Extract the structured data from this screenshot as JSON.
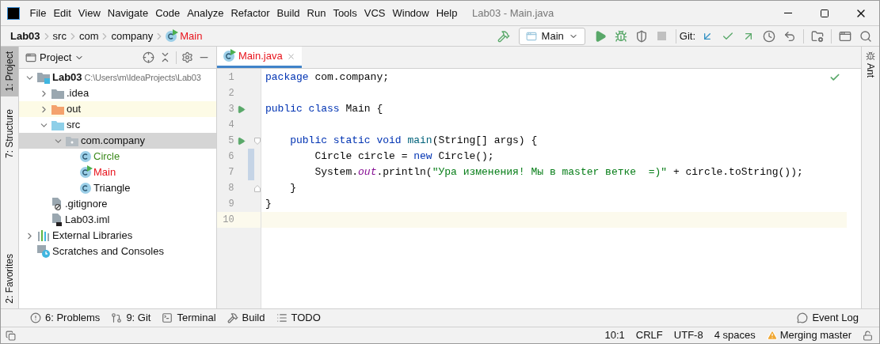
{
  "window": {
    "title": "Lab03 - Main.java"
  },
  "menu": [
    "File",
    "Edit",
    "View",
    "Navigate",
    "Code",
    "Analyze",
    "Refactor",
    "Build",
    "Run",
    "Tools",
    "VCS",
    "Window",
    "Help"
  ],
  "breadcrumbs": [
    {
      "label": "Lab03",
      "kind": "project"
    },
    {
      "label": "src",
      "kind": "dir"
    },
    {
      "label": "com",
      "kind": "dir"
    },
    {
      "label": "company",
      "kind": "dir"
    },
    {
      "label": "Main",
      "kind": "class"
    }
  ],
  "toolbar": {
    "run_config": "Main",
    "git_label": "Git:"
  },
  "left_stripe": [
    {
      "label": "1: Project",
      "selected": true
    },
    {
      "label": "7: Structure",
      "selected": false
    },
    {
      "label": "2: Favorites",
      "selected": false
    }
  ],
  "right_stripe": [
    {
      "label": "Ant"
    }
  ],
  "project_panel": {
    "title": "Project",
    "tree": [
      {
        "name": "Lab03",
        "path": "C:\\Users\\m\\IdeaProjects\\Lab03",
        "kind": "module",
        "selected": false,
        "expanded": true,
        "children": [
          {
            "name": ".idea",
            "kind": "folder",
            "selected": false,
            "expanded": false
          },
          {
            "name": "out",
            "kind": "folder-excluded",
            "selected": false,
            "expanded": false
          },
          {
            "name": "src",
            "kind": "folder-source",
            "selected": false,
            "expanded": true,
            "children": [
              {
                "name": "com.company",
                "kind": "package",
                "selected": true,
                "expanded": true,
                "children": [
                  {
                    "name": "Circle",
                    "kind": "class",
                    "color": "#3c8a1c",
                    "selected": false
                  },
                  {
                    "name": "Main",
                    "kind": "class-main",
                    "color": "#e8141d",
                    "selected": false
                  },
                  {
                    "name": "Triangle",
                    "kind": "class",
                    "selected": false
                  }
                ]
              }
            ]
          },
          {
            "name": ".gitignore",
            "kind": "file-ignore",
            "selected": false
          },
          {
            "name": "Lab03.iml",
            "kind": "file-iml",
            "selected": false
          }
        ]
      },
      {
        "name": "External Libraries",
        "kind": "libraries",
        "selected": false,
        "expanded": false
      },
      {
        "name": "Scratches and Consoles",
        "kind": "scratches",
        "selected": false
      }
    ]
  },
  "editor": {
    "tabs": [
      {
        "label": "Main.java",
        "color": "#e8141d",
        "selected": true
      }
    ],
    "lines": [
      {
        "number": "1",
        "run": false,
        "fold_open": false,
        "fold_close": false,
        "changed": false,
        "current": false,
        "tokens": [
          {
            "kind": "kw",
            "text": "package"
          },
          {
            "kind": "plain",
            "text": " com.company;"
          }
        ]
      },
      {
        "number": "2",
        "run": false,
        "fold_open": false,
        "fold_close": false,
        "changed": false,
        "current": false
      },
      {
        "number": "3",
        "run": true,
        "fold_open": false,
        "fold_close": false,
        "changed": false,
        "current": false,
        "tokens": [
          {
            "kind": "kw",
            "text": "public class"
          },
          {
            "kind": "plain",
            "text": " Main {"
          }
        ]
      },
      {
        "number": "4",
        "run": false,
        "fold_open": false,
        "fold_close": false,
        "changed": false,
        "current": false
      },
      {
        "number": "5",
        "run": true,
        "fold_open": true,
        "fold_close": false,
        "changed": false,
        "current": false,
        "tokens": [
          {
            "kind": "kw",
            "text": "    public static void "
          },
          {
            "kind": "fn",
            "text": "main"
          },
          {
            "kind": "plain",
            "text": "(String[] args) {"
          }
        ]
      },
      {
        "number": "6",
        "run": false,
        "fold_open": false,
        "fold_close": false,
        "changed": true,
        "current": false,
        "tokens": [
          {
            "kind": "plain",
            "text": "        Circle circle = "
          },
          {
            "kind": "kw",
            "text": "new"
          },
          {
            "kind": "plain",
            "text": " Circle();"
          }
        ]
      },
      {
        "number": "7",
        "run": false,
        "fold_open": false,
        "fold_close": false,
        "changed": true,
        "current": false,
        "tokens": [
          {
            "kind": "plain",
            "text": "        System."
          },
          {
            "kind": "field",
            "text": "out"
          },
          {
            "kind": "plain",
            "text": ".println("
          },
          {
            "kind": "str",
            "text": "\"Ура изменения! Мы в master ветке  =)\""
          },
          {
            "kind": "plain",
            "text": " + circle.toString());"
          }
        ]
      },
      {
        "number": "8",
        "run": false,
        "fold_open": false,
        "fold_close": true,
        "changed": false,
        "current": false,
        "tokens": [
          {
            "kind": "plain",
            "text": "    }"
          }
        ]
      },
      {
        "number": "9",
        "run": false,
        "fold_open": false,
        "fold_close": false,
        "changed": false,
        "current": false,
        "tokens": [
          {
            "kind": "plain",
            "text": "}"
          }
        ]
      },
      {
        "number": "10",
        "run": false,
        "fold_open": false,
        "fold_close": false,
        "changed": false,
        "current": true
      }
    ]
  },
  "tool_windows": [
    "6: Problems",
    "9: Git",
    "Terminal",
    "Build",
    "TODO"
  ],
  "event_log": "Event Log",
  "status_bar": {
    "position": "10:1",
    "line_separator": "CRLF",
    "encoding": "UTF-8",
    "indent": "4 spaces",
    "vcs": "Merging master"
  }
}
